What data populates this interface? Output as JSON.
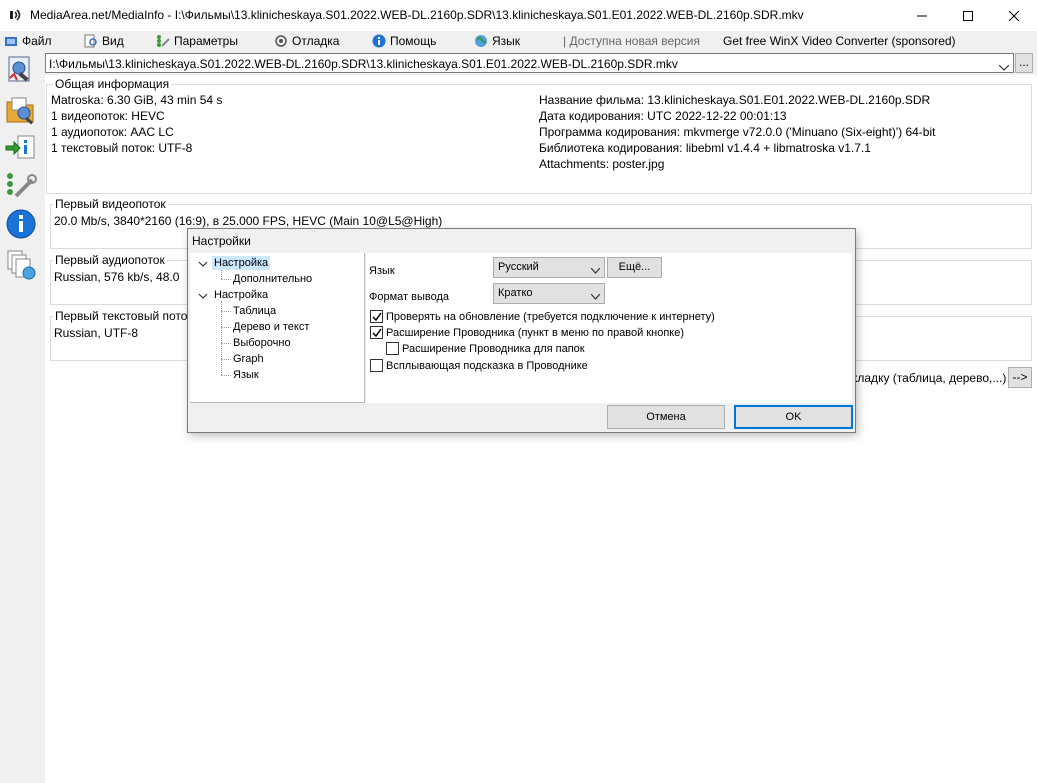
{
  "window": {
    "title": "MediaArea.net/MediaInfo - I:\\Фильмы\\13.klinicheskaya.S01.2022.WEB-DL.2160p.SDR\\13.klinicheskaya.S01.E01.2022.WEB-DL.2160p.SDR.mkv"
  },
  "menu": {
    "file": "Файл",
    "view": "Вид",
    "options": "Параметры",
    "debug": "Отладка",
    "help": "Помощь",
    "language": "Язык",
    "new_version": "| Доступна новая версия",
    "sponsored": "Get free WinX Video Converter (sponsored)"
  },
  "file_combo": {
    "value": "I:\\Фильмы\\13.klinicheskaya.S01.2022.WEB-DL.2160p.SDR\\13.klinicheskaya.S01.E01.2022.WEB-DL.2160p.SDR.mkv",
    "more": "..."
  },
  "general": {
    "title": "Общая информация",
    "left": [
      "Matroska: 6.30 GiB, 43 min 54 s",
      "1 видеопоток: HEVC",
      "1 аудиопоток: AAC LC",
      "1 текстовый поток: UTF-8"
    ],
    "right": [
      "Название фильма: 13.klinicheskaya.S01.E01.2022.WEB-DL.2160p.SDR",
      "Дата кодирования: UTC 2022-12-22 00:01:13",
      "Программа кодирования: mkvmerge v72.0.0 ('Minuano (Six-eight)') 64-bit",
      "Библиотека кодирования: libebml v1.4.4 + libmatroska v1.7.1",
      "Attachments: poster.jpg"
    ]
  },
  "video": {
    "title": "Первый видеопоток",
    "line": "20.0 Mb/s, 3840*2160 (16:9), в 25.000 FPS, HEVC (Main 10@L5@High)"
  },
  "audio": {
    "title": "Первый аудиопоток",
    "line": "Russian, 576 kb/s, 48.0"
  },
  "text": {
    "title": "Первый текстовый пото",
    "line": "Russian, UTF-8"
  },
  "tab_hint": "кладку (таблица, дерево,...)",
  "arrow_btn": "-->",
  "dialog": {
    "title": "Настройки",
    "tree": [
      {
        "label": "Настройка",
        "selected": true
      },
      {
        "label": "Дополнительно"
      },
      {
        "label": "Настройка"
      },
      {
        "label": "Таблица"
      },
      {
        "label": "Дерево и текст"
      },
      {
        "label": "Выборочно"
      },
      {
        "label": "Graph"
      },
      {
        "label": "Язык"
      }
    ],
    "language_label": "Язык",
    "language_value": "Русский",
    "more_button": "Ещё...",
    "format_label": "Формат вывода",
    "format_value": "Кратко",
    "checkboxes": [
      {
        "label": "Проверять на обновление (требуется подключение к интернету)",
        "checked": true
      },
      {
        "label": "Расширение Проводника (пункт в меню по правой кнопке)",
        "checked": true
      },
      {
        "label": "Расширение Проводника для папок",
        "checked": false
      },
      {
        "label": "Всплывающая подсказка в Проводнике",
        "checked": false
      }
    ],
    "cancel": "Отмена",
    "ok": "OK"
  },
  "colors": {
    "accent": "#0078d7",
    "selection": "#cce8ff"
  }
}
